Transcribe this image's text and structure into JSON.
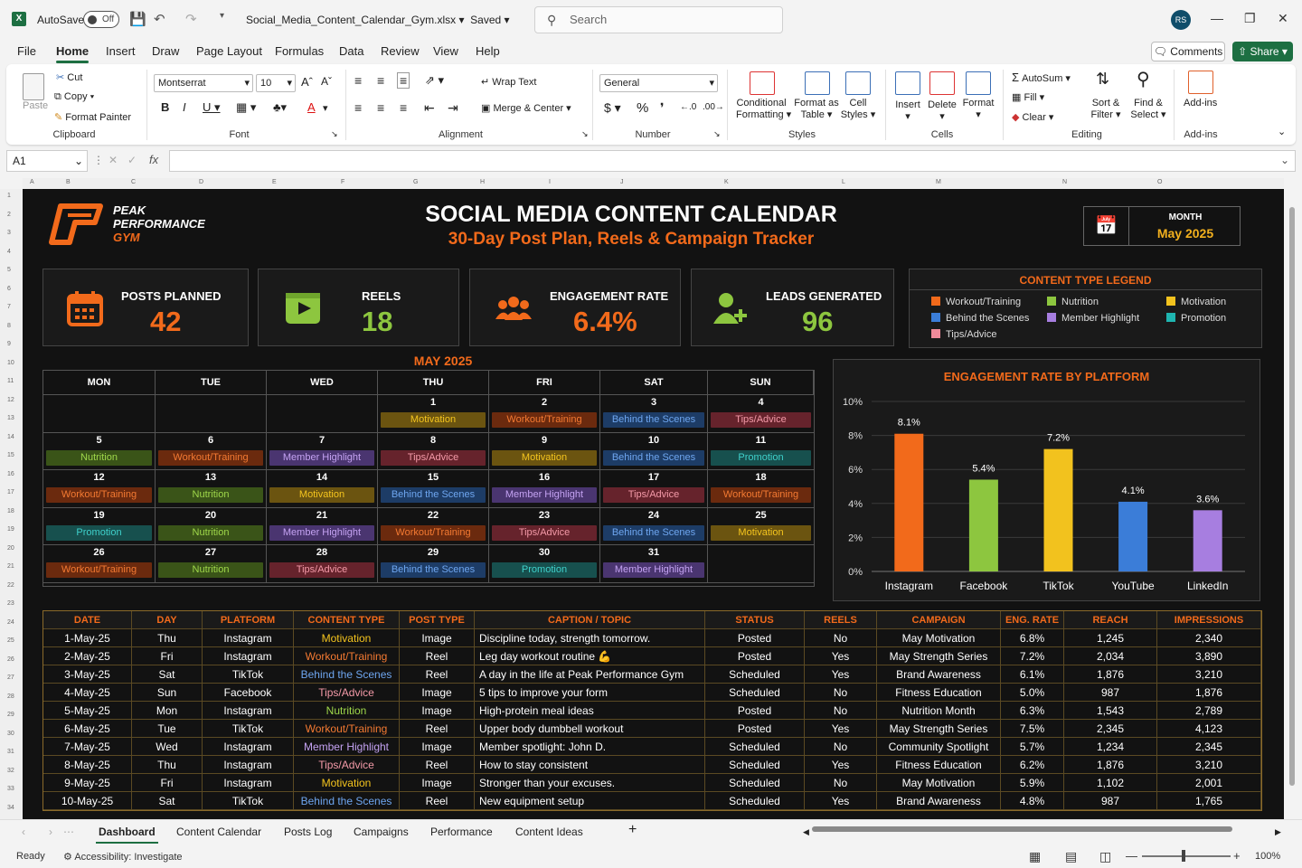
{
  "titlebar": {
    "autosave": "AutoSave",
    "toggle": "Off",
    "filename": "Social_Media_Content_Calendar_Gym.xlsx",
    "saved": "Saved",
    "search_placeholder": "Search",
    "user_initials": "RS"
  },
  "menu": {
    "items": [
      "File",
      "Home",
      "Insert",
      "Draw",
      "Page Layout",
      "Formulas",
      "Data",
      "Review",
      "View",
      "Help"
    ],
    "comments": "Comments",
    "share": "Share"
  },
  "ribbon": {
    "paste": "Paste",
    "cut": "Cut",
    "copy": "Copy",
    "format_painter": "Format Painter",
    "clipboard": "Clipboard",
    "font_name": "Montserrat",
    "font_size": "10",
    "font_group": "Font",
    "wrap_text": "Wrap Text",
    "merge_center": "Merge & Center",
    "alignment": "Alignment",
    "number_format": "General",
    "number": "Number",
    "conditional": "Conditional",
    "formatting": "Formatting",
    "format_as": "Format as",
    "table": "Table",
    "cell": "Cell",
    "styles_l": "Styles",
    "styles": "Styles",
    "insert": "Insert",
    "delete": "Delete",
    "format": "Format",
    "cells": "Cells",
    "autosum": "AutoSum",
    "fill": "Fill",
    "clear": "Clear",
    "sort": "Sort &",
    "filter": "Filter",
    "find": "Find &",
    "select": "Select",
    "editing": "Editing",
    "addins": "Add-ins",
    "addins_group": "Add-ins"
  },
  "formula_bar": {
    "name_box": "A1",
    "fx": "fx",
    "value": ""
  },
  "header": {
    "logo": [
      "PEAK",
      "PERFORMANCE",
      "GYM"
    ],
    "title": "SOCIAL MEDIA CONTENT CALENDAR",
    "subtitle": "30-Day Post Plan, Reels & Campaign Tracker",
    "month_label": "MONTH",
    "month_value": "May 2025"
  },
  "kpis": [
    {
      "label": "POSTS PLANNED",
      "value": "42",
      "icon": "calendar-icon",
      "color": "#f26a1b"
    },
    {
      "label": "REELS",
      "value": "18",
      "icon": "video-icon",
      "color": "#8dc63f"
    },
    {
      "label": "ENGAGEMENT RATE",
      "value": "6.4%",
      "icon": "people-icon",
      "color": "#f26a1b"
    },
    {
      "label": "LEADS GENERATED",
      "value": "96",
      "icon": "add-user-icon",
      "color": "#8dc63f"
    }
  ],
  "legend": {
    "title": "CONTENT TYPE LEGEND",
    "items": [
      {
        "label": "Workout/Training",
        "color": "#f26a1b"
      },
      {
        "label": "Nutrition",
        "color": "#8dc63f"
      },
      {
        "label": "Motivation",
        "color": "#f2c21e"
      },
      {
        "label": "Behind the Scenes",
        "color": "#3b7dd8"
      },
      {
        "label": "Member Highlight",
        "color": "#a77ee0"
      },
      {
        "label": "Promotion",
        "color": "#1fb5b0"
      },
      {
        "label": "Tips/Advice",
        "color": "#f08a9a"
      }
    ]
  },
  "calendar": {
    "title": "MAY 2025",
    "days": [
      "MON",
      "TUE",
      "WED",
      "THU",
      "FRI",
      "SAT",
      "SUN"
    ],
    "weeks": [
      [
        null,
        null,
        null,
        {
          "d": "1",
          "t": "Motivation"
        },
        {
          "d": "2",
          "t": "Workout/Training"
        },
        {
          "d": "3",
          "t": "Behind the Scenes"
        },
        {
          "d": "4",
          "t": "Tips/Advice"
        }
      ],
      [
        {
          "d": "5",
          "t": "Nutrition"
        },
        {
          "d": "6",
          "t": "Workout/Training"
        },
        {
          "d": "7",
          "t": "Member Highlight"
        },
        {
          "d": "8",
          "t": "Tips/Advice"
        },
        {
          "d": "9",
          "t": "Motivation"
        },
        {
          "d": "10",
          "t": "Behind the Scenes"
        },
        {
          "d": "11",
          "t": "Promotion"
        }
      ],
      [
        {
          "d": "12",
          "t": "Workout/Training"
        },
        {
          "d": "13",
          "t": "Nutrition"
        },
        {
          "d": "14",
          "t": "Motivation"
        },
        {
          "d": "15",
          "t": "Behind the Scenes"
        },
        {
          "d": "16",
          "t": "Member Highlight"
        },
        {
          "d": "17",
          "t": "Tips/Advice"
        },
        {
          "d": "18",
          "t": "Workout/Training"
        }
      ],
      [
        {
          "d": "19",
          "t": "Promotion"
        },
        {
          "d": "20",
          "t": "Nutrition"
        },
        {
          "d": "21",
          "t": "Member Highlight"
        },
        {
          "d": "22",
          "t": "Workout/Training"
        },
        {
          "d": "23",
          "t": "Tips/Advice"
        },
        {
          "d": "24",
          "t": "Behind the Scenes"
        },
        {
          "d": "25",
          "t": "Motivation"
        }
      ],
      [
        {
          "d": "26",
          "t": "Workout/Training"
        },
        {
          "d": "27",
          "t": "Nutrition"
        },
        {
          "d": "28",
          "t": "Tips/Advice"
        },
        {
          "d": "29",
          "t": "Behind the Scenes"
        },
        {
          "d": "30",
          "t": "Promotion"
        },
        {
          "d": "31",
          "t": "Member Highlight"
        },
        null
      ]
    ],
    "tag_styles": {
      "Workout/Training": {
        "bg": "#6b2a0e",
        "fg": "#f47a32"
      },
      "Nutrition": {
        "bg": "#3a5418",
        "fg": "#9fd84a"
      },
      "Motivation": {
        "bg": "#6b5410",
        "fg": "#f5c51e"
      },
      "Behind the Scenes": {
        "bg": "#1d3c66",
        "fg": "#6ea6f0"
      },
      "Member Highlight": {
        "bg": "#4a3570",
        "fg": "#c4a2f2"
      },
      "Promotion": {
        "bg": "#17504e",
        "fg": "#3fd1cb"
      },
      "Tips/Advice": {
        "bg": "#66232c",
        "fg": "#f49aa8"
      }
    }
  },
  "chart_data": {
    "type": "bar",
    "title": "ENGAGEMENT RATE BY PLATFORM",
    "categories": [
      "Instagram",
      "Facebook",
      "TikTok",
      "YouTube",
      "LinkedIn"
    ],
    "values": [
      8.1,
      5.4,
      7.2,
      4.1,
      3.6
    ],
    "value_labels": [
      "8.1%",
      "5.4%",
      "7.2%",
      "4.1%",
      "3.6%"
    ],
    "colors": [
      "#f26a1b",
      "#8dc63f",
      "#f2c21e",
      "#3b7dd8",
      "#a77ee0"
    ],
    "yticks": [
      "0%",
      "2%",
      "4%",
      "6%",
      "8%",
      "10%"
    ],
    "ylim": [
      0,
      10
    ],
    "grid": true
  },
  "table": {
    "headers": [
      "DATE",
      "DAY",
      "PLATFORM",
      "CONTENT TYPE",
      "POST TYPE",
      "CAPTION / TOPIC",
      "STATUS",
      "REELS",
      "CAMPAIGN",
      "ENG. RATE",
      "REACH",
      "IMPRESSIONS"
    ],
    "rows": [
      [
        "1-May-25",
        "Thu",
        "Instagram",
        "Motivation",
        "Image",
        "Discipline today, strength tomorrow.",
        "Posted",
        "No",
        "May Motivation",
        "6.8%",
        "1,245",
        "2,340"
      ],
      [
        "2-May-25",
        "Fri",
        "Instagram",
        "Workout/Training",
        "Reel",
        "Leg day workout routine 💪",
        "Posted",
        "Yes",
        "May Strength Series",
        "7.2%",
        "2,034",
        "3,890"
      ],
      [
        "3-May-25",
        "Sat",
        "TikTok",
        "Behind the Scenes",
        "Reel",
        "A day in the life at Peak Performance Gym",
        "Scheduled",
        "Yes",
        "Brand Awareness",
        "6.1%",
        "1,876",
        "3,210"
      ],
      [
        "4-May-25",
        "Sun",
        "Facebook",
        "Tips/Advice",
        "Image",
        "5 tips to improve your form",
        "Scheduled",
        "No",
        "Fitness Education",
        "5.0%",
        "987",
        "1,876"
      ],
      [
        "5-May-25",
        "Mon",
        "Instagram",
        "Nutrition",
        "Image",
        "High-protein meal ideas",
        "Posted",
        "No",
        "Nutrition Month",
        "6.3%",
        "1,543",
        "2,789"
      ],
      [
        "6-May-25",
        "Tue",
        "TikTok",
        "Workout/Training",
        "Reel",
        "Upper body dumbbell workout",
        "Posted",
        "Yes",
        "May Strength Series",
        "7.5%",
        "2,345",
        "4,123"
      ],
      [
        "7-May-25",
        "Wed",
        "Instagram",
        "Member Highlight",
        "Image",
        "Member spotlight: John D.",
        "Scheduled",
        "No",
        "Community Spotlight",
        "5.7%",
        "1,234",
        "2,345"
      ],
      [
        "8-May-25",
        "Thu",
        "Instagram",
        "Tips/Advice",
        "Reel",
        "How to stay consistent",
        "Scheduled",
        "Yes",
        "Fitness Education",
        "6.2%",
        "1,876",
        "3,210"
      ],
      [
        "9-May-25",
        "Fri",
        "Instagram",
        "Motivation",
        "Image",
        "Stronger than your excuses.",
        "Scheduled",
        "No",
        "May Motivation",
        "5.9%",
        "1,102",
        "2,001"
      ],
      [
        "10-May-25",
        "Sat",
        "TikTok",
        "Behind the Scenes",
        "Reel",
        "New equipment setup",
        "Scheduled",
        "Yes",
        "Brand Awareness",
        "4.8%",
        "987",
        "1,765"
      ]
    ]
  },
  "sheet_tabs": [
    "Dashboard",
    "Content Calendar",
    "Posts Log",
    "Campaigns",
    "Performance",
    "Content Ideas"
  ],
  "status": {
    "ready": "Ready",
    "accessibility": "Accessibility: Investigate",
    "zoom": "100%"
  },
  "col_letters": [
    "A",
    "B",
    "C",
    "D",
    "E",
    "F",
    "G",
    "H",
    "I",
    "J",
    "K",
    "L",
    "M",
    "N",
    "O"
  ]
}
